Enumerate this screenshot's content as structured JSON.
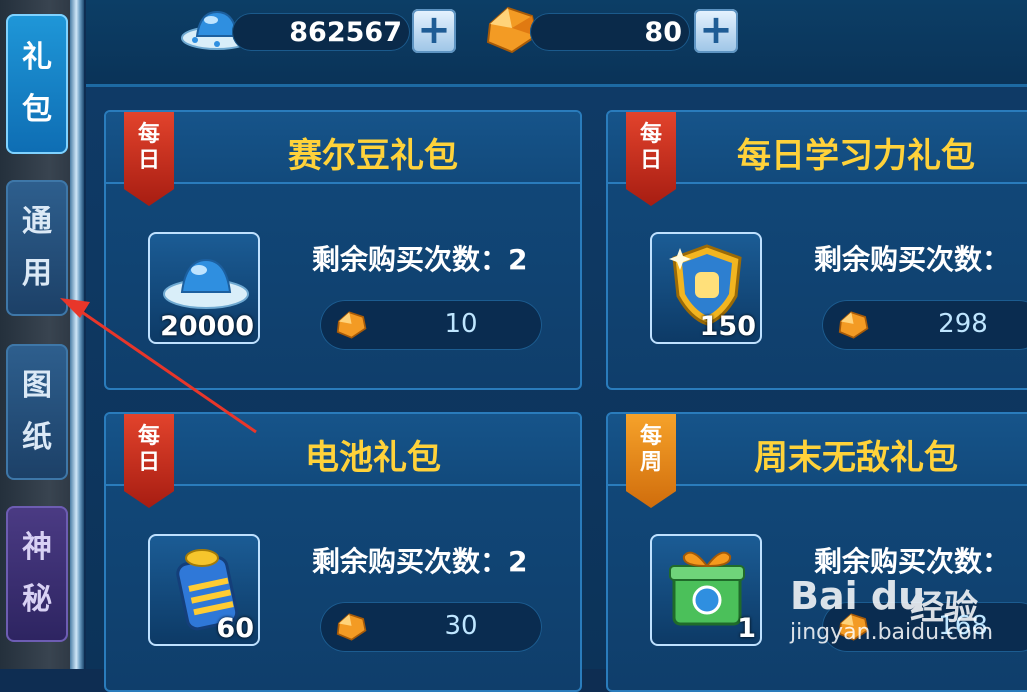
{
  "sidebar": {
    "tabs": [
      {
        "label_top": "礼",
        "label_bottom": "包",
        "active": true
      },
      {
        "label_top": "通",
        "label_bottom": "用",
        "active": false
      },
      {
        "label_top": "图",
        "label_bottom": "纸",
        "active": false
      },
      {
        "label_top": "神",
        "label_bottom": "秘",
        "active": false
      }
    ]
  },
  "currency": {
    "beans": {
      "icon": "ufo-bean-icon",
      "value": "862567"
    },
    "gems": {
      "icon": "orange-gem-icon",
      "value": "80"
    },
    "plus_label": "+"
  },
  "cards": [
    {
      "badge_top": "每",
      "badge_bottom": "日",
      "badge_color": "#c62a1c",
      "title": "赛尔豆礼包",
      "item_icon": "ufo-bean-icon",
      "item_qty": "20000",
      "remain": "剩余购买次数：2",
      "price": "10"
    },
    {
      "badge_top": "每",
      "badge_bottom": "日",
      "badge_color": "#c62a1c",
      "title": "每日学习力礼包",
      "item_icon": "shield-fist-icon",
      "item_qty": "150",
      "remain": "剩余购买次数：",
      "price": "298"
    },
    {
      "badge_top": "每",
      "badge_bottom": "日",
      "badge_color": "#c62a1c",
      "title": "电池礼包",
      "item_icon": "battery-icon",
      "item_qty": "60",
      "remain": "剩余购买次数：2",
      "price": "30"
    },
    {
      "badge_top": "每",
      "badge_bottom": "周",
      "badge_color": "#e88a18",
      "title": "周末无敌礼包",
      "item_icon": "gift-box-icon",
      "item_qty": "1",
      "remain": "剩余购买次数：",
      "price": "168"
    }
  ],
  "watermark": {
    "logo": "Bai du",
    "text": "经验",
    "url": "jingyan.baidu.com"
  }
}
